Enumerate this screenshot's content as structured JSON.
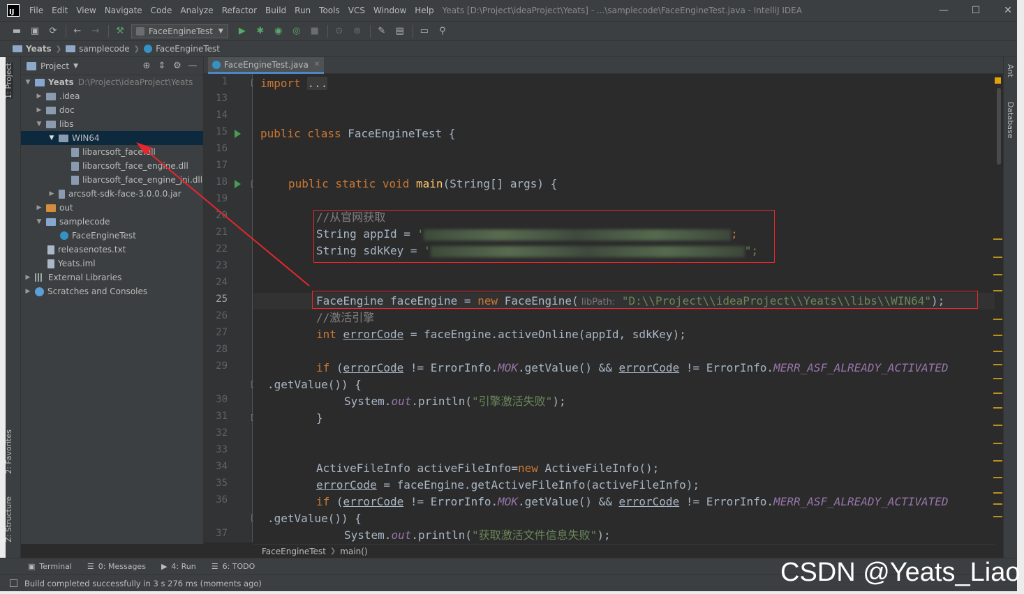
{
  "window": {
    "title": "Yeats [D:\\Project\\ideaProject\\Yeats] - ...\\samplecode\\FaceEngineTest.java - IntelliJ IDEA",
    "logo_text": "IJ",
    "controls": [
      "—",
      "☐",
      "✕"
    ]
  },
  "menu": [
    "File",
    "Edit",
    "View",
    "Navigate",
    "Code",
    "Analyze",
    "Refactor",
    "Build",
    "Run",
    "Tools",
    "VCS",
    "Window",
    "Help"
  ],
  "toolbar": {
    "run_config": "FaceEngineTest"
  },
  "breadcrumb": [
    "Yeats",
    "samplecode",
    "FaceEngineTest"
  ],
  "left_stripe": {
    "project": "1: Project",
    "favorites": "2: Favorites",
    "structure": "Z: Structure"
  },
  "right_stripe": {
    "ant": "Ant",
    "database": "Database"
  },
  "project_panel": {
    "title": "Project",
    "tree": [
      {
        "label": "Yeats",
        "hint": "D:\\Project\\ideaProject\\Yeats"
      },
      {
        "label": ".idea"
      },
      {
        "label": "doc"
      },
      {
        "label": "libs"
      },
      {
        "label": "WIN64"
      },
      {
        "label": "libarcsoft_face.dll"
      },
      {
        "label": "libarcsoft_face_engine.dll"
      },
      {
        "label": "libarcsoft_face_engine_jni.dll"
      },
      {
        "label": "arcsoft-sdk-face-3.0.0.0.jar"
      },
      {
        "label": "out"
      },
      {
        "label": "samplecode"
      },
      {
        "label": "FaceEngineTest"
      },
      {
        "label": "releasenotes.txt"
      },
      {
        "label": "Yeats.iml"
      },
      {
        "label": "External Libraries"
      },
      {
        "label": "Scratches and Consoles"
      }
    ]
  },
  "editor": {
    "tab": "FaceEngineTest.java",
    "line_numbers": [
      "1",
      "13",
      "14",
      "15",
      "16",
      "17",
      "18",
      "19",
      "20",
      "21",
      "22",
      "23",
      "24",
      "25",
      "26",
      "27",
      "28",
      "29",
      "",
      "30",
      "31",
      "32",
      "33",
      "34",
      "35",
      "36",
      "",
      "37"
    ],
    "current_line": "25",
    "code": {
      "l1_kw": "import",
      "l1_dots": "...",
      "l15_kw": "public class",
      "l15_rest": " FaceEngineTest {",
      "l18_kw": "public static void",
      "l18_meth": "main",
      "l18_rest": "(String[] args) {",
      "l20_cmt": "//从官网获取",
      "l21_a": "String appId = ",
      "l21_q": "'",
      "l21_end": ";",
      "l22_a": "String sdkKey = ",
      "l22_q": "'",
      "l22_end": "\";",
      "l25_a": "FaceEngine faceEngine = ",
      "l25_kw": "new",
      "l25_b": " FaceEngine(",
      "l25_hint": " libPath:",
      "l25_str": " \"D:\\\\Project\\\\ideaProject\\\\Yeats\\\\libs\\\\WIN64\"",
      "l25_end": ");",
      "l26_cmt": "//激活引擎",
      "l27_kw": "int",
      "l27_var": "errorCode",
      "l27_rest": " = faceEngine.activeOnline(appId, sdkKey);",
      "l29_kw": "if",
      "l29_var": "errorCode",
      "l29_mid": " != ErrorInfo.",
      "l29_f1": "MOK",
      "l29_mid2": ".getValue() && ",
      "l29_var2": "errorCode",
      "l29_mid3": " != ErrorInfo.",
      "l29_f2": "MERR_ASF_ALREADY_ACTIVATED",
      "l29b": ".getValue()) {",
      "l30_a": "System.",
      "l30_out": "out",
      "l30_b": ".println(",
      "l30_str": "\"引擎激活失败\"",
      "l30_end": ");",
      "l31": "}",
      "l34_a": "ActiveFileInfo activeFileInfo=",
      "l34_kw": "new",
      "l34_b": " ActiveFileInfo();",
      "l35_var": "errorCode",
      "l35_rest": " = faceEngine.getActiveFileInfo(activeFileInfo);",
      "l36_kw": "if",
      "l36_var": "errorCode",
      "l36_mid": " != ErrorInfo.",
      "l36_f1": "MOK",
      "l36_mid2": ".getValue() && ",
      "l36_var2": "errorCode",
      "l36_mid3": " != ErrorInfo.",
      "l36_f2": "MERR_ASF_ALREADY_ACTIVATED",
      "l36b": ".getValue()) {",
      "l37_a": "System.",
      "l37_out": "out",
      "l37_b": ".println(",
      "l37_str": "\"获取激活文件信息失败\"",
      "l37_end": ");"
    },
    "crumb": [
      "FaceEngineTest",
      "main()"
    ]
  },
  "bottom_tabs": [
    "Terminal",
    "0: Messages",
    "4: Run",
    "6: TODO"
  ],
  "status": "Build completed successfully in 3 s 276 ms (moments ago)",
  "watermark": "CSDN @Yeats_Liao",
  "colors": {
    "keyword": "#cc7832",
    "string": "#6a8759",
    "comment": "#808080",
    "annotation_red": "#e8262d",
    "selection": "#0d293e"
  }
}
